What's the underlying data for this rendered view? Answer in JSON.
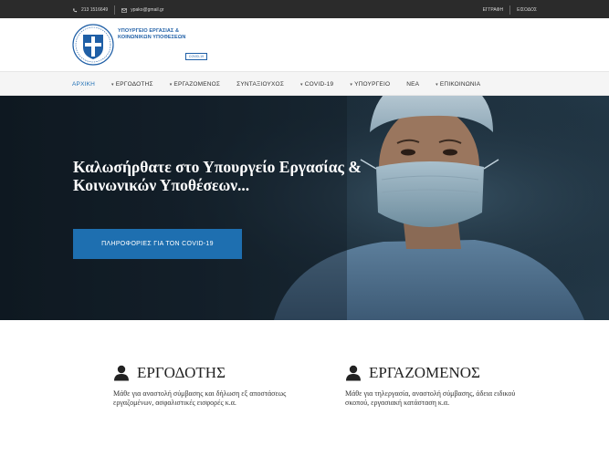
{
  "topbar": {
    "phone": "213 1516649",
    "email": "ypako@gmail.gr",
    "register": "ΕΓΓΡΑΦΗ",
    "login": "ΕΙΣΟΔΟΣ"
  },
  "header": {
    "logo_line1": "ΥΠΟΥΡΓΕΙΟ ΕΡΓΑΣΙΑΣ &",
    "logo_line2": "ΚΟΙΝΩΝΙΚΩΝ ΥΠΟΘΕΣΕΩΝ",
    "logo_tag": "COVID-19"
  },
  "nav": {
    "items": [
      {
        "label": "ΑΡΧΙΚΗ",
        "dropdown": false,
        "active": true
      },
      {
        "label": "ΕΡΓΟΔΟΤΗΣ",
        "dropdown": true
      },
      {
        "label": "ΕΡΓΑΖΟΜΕΝΟΣ",
        "dropdown": true
      },
      {
        "label": "ΣΥΝΤΑΞΙΟΥΧΟΣ",
        "dropdown": false
      },
      {
        "label": "COVID-19",
        "dropdown": true
      },
      {
        "label": "ΥΠΟΥΡΓΕΙΟ",
        "dropdown": true
      },
      {
        "label": "ΝΕΑ",
        "dropdown": false
      },
      {
        "label": "ΕΠΙΚΟΙΝΩΝΙΑ",
        "dropdown": true
      }
    ]
  },
  "hero": {
    "title_line1": "Καλωσήρθατε στο Υπουργείο Εργασίας &",
    "title_line2": "Κοινωνικών Υποθέσεων...",
    "button": "ΠΛΗΡΟΦΟΡΙΕΣ ΓΙΑ ΤΟΝ COVID-19"
  },
  "features": [
    {
      "title": "ΕΡΓΟΔΟΤΗΣ",
      "text": "Μάθε για αναστολή σύμβασης και δήλωση εξ αποστάσεως εργαζομένων, ασφαλιστικές εισφορές κ.α."
    },
    {
      "title": "ΕΡΓΑΖΟΜΕΝΟΣ",
      "text": "Μάθε για τηλεργασία, αναστολή σύμβασης, άδεια ειδικού σκοπού, εργασιακή κατάσταση κ.α."
    }
  ],
  "colors": {
    "accent": "#1e6fb0",
    "topbar": "#2b2b2b",
    "nav_bg": "#f5f5f5"
  }
}
